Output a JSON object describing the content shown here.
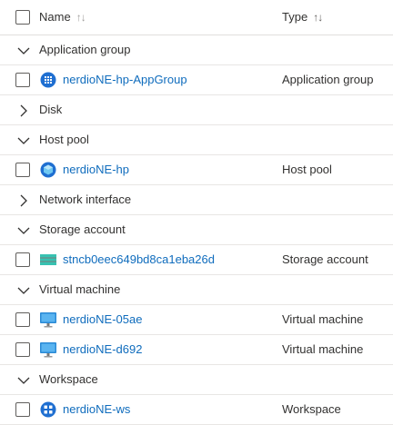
{
  "header": {
    "name_label": "Name",
    "type_label": "Type",
    "sort_icon": "sort-arrows-icon"
  },
  "groups": [
    {
      "label": "Application group",
      "expanded": true,
      "items": [
        {
          "name": "nerdioNE-hp-AppGroup",
          "type": "Application group",
          "icon": "application-group-icon"
        }
      ]
    },
    {
      "label": "Disk",
      "expanded": false,
      "items": []
    },
    {
      "label": "Host pool",
      "expanded": true,
      "items": [
        {
          "name": "nerdioNE-hp",
          "type": "Host pool",
          "icon": "host-pool-icon"
        }
      ]
    },
    {
      "label": "Network interface",
      "expanded": false,
      "items": []
    },
    {
      "label": "Storage account",
      "expanded": true,
      "items": [
        {
          "name": "stncb0eec649bd8ca1eba26d",
          "type": "Storage account",
          "icon": "storage-account-icon"
        }
      ]
    },
    {
      "label": "Virtual machine",
      "expanded": true,
      "items": [
        {
          "name": "nerdioNE-05ae",
          "type": "Virtual machine",
          "icon": "virtual-machine-icon"
        },
        {
          "name": "nerdioNE-d692",
          "type": "Virtual machine",
          "icon": "virtual-machine-icon"
        }
      ]
    },
    {
      "label": "Workspace",
      "expanded": true,
      "items": [
        {
          "name": "nerdioNE-ws",
          "type": "Workspace",
          "icon": "workspace-icon"
        }
      ]
    }
  ],
  "colors": {
    "link": "#0f6cbd",
    "text": "#323130",
    "border": "#e1dfdd"
  }
}
